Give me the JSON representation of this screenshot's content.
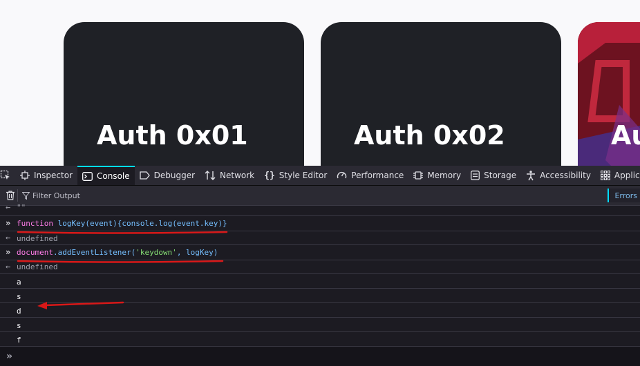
{
  "cards": [
    {
      "title": "Auth 0x01"
    },
    {
      "title": "Auth 0x02"
    },
    {
      "title": "Au"
    }
  ],
  "devtools": {
    "tabs": [
      {
        "label": "Inspector",
        "icon": "inspector-icon"
      },
      {
        "label": "Console",
        "icon": "console-icon",
        "active": true
      },
      {
        "label": "Debugger",
        "icon": "debugger-icon"
      },
      {
        "label": "Network",
        "icon": "network-icon"
      },
      {
        "label": "Style Editor",
        "icon": "style-editor-icon"
      },
      {
        "label": "Performance",
        "icon": "performance-icon"
      },
      {
        "label": "Memory",
        "icon": "memory-icon"
      },
      {
        "label": "Storage",
        "icon": "storage-icon"
      },
      {
        "label": "Accessibility",
        "icon": "accessibility-icon"
      },
      {
        "label": "Applicatio",
        "icon": "application-icon"
      }
    ],
    "filter_placeholder": "Filter Output",
    "errors_label": "Errors",
    "console": {
      "prev_result": "\"\"",
      "cmd1": {
        "kw": "function",
        "name": "logKey",
        "rest": "(event){console.log(event.key)}"
      },
      "result1": "undefined",
      "cmd2": {
        "obj": "document",
        "method": ".addEventListener(",
        "arg": "'keydown'",
        "tail": ", logKey)"
      },
      "result2": "undefined",
      "logs": [
        "a",
        "s",
        "d",
        "s",
        "f"
      ]
    }
  },
  "colors": {
    "accent": "#00ddff",
    "annotation": "#e01b1b",
    "card_bg": "#1f2126",
    "devtools_bg": "#1c1b22"
  }
}
